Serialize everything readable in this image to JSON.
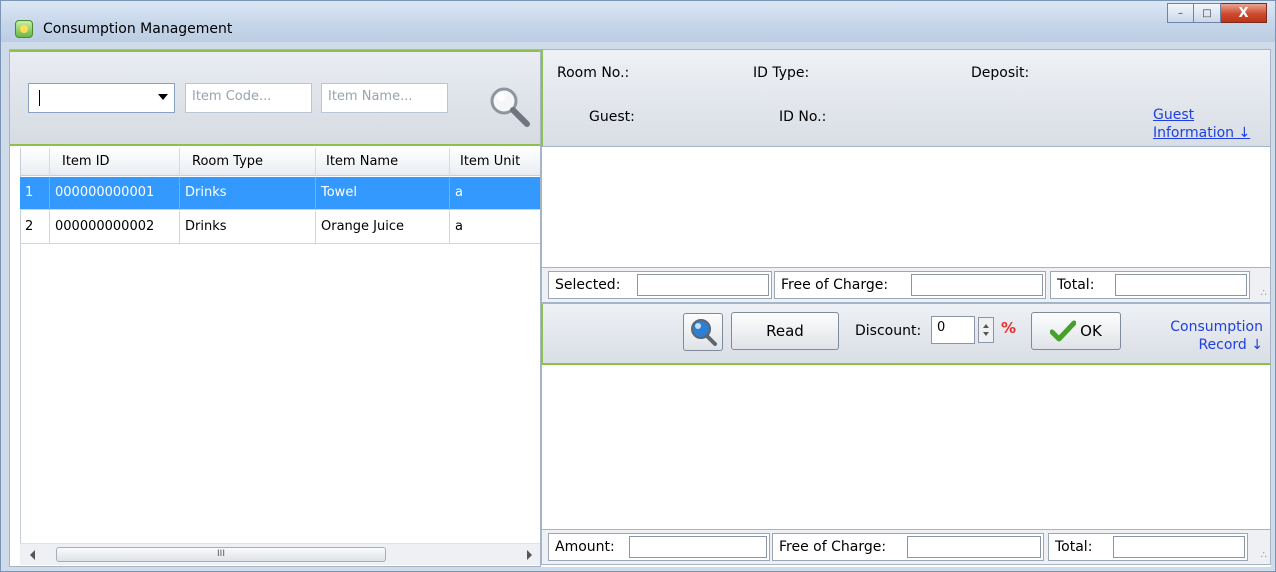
{
  "window": {
    "title": "Consumption Management",
    "controls": {
      "minimize": "–",
      "maximize": "□",
      "close": "X"
    }
  },
  "search": {
    "combo_value": "",
    "item_code_placeholder": "Item Code...",
    "item_name_placeholder": "Item Name..."
  },
  "grid": {
    "columns": [
      "Item ID",
      "Room Type",
      "Item Name",
      "Item Unit"
    ],
    "rows": [
      {
        "num": "1",
        "item_id": "000000000001",
        "room_type": "Drinks",
        "item_name": "Towel",
        "item_unit": "a",
        "selected": true
      },
      {
        "num": "2",
        "item_id": "000000000002",
        "room_type": "Drinks",
        "item_name": "Orange Juice",
        "item_unit": "a",
        "selected": false
      }
    ],
    "scroll_thumb": "III"
  },
  "info": {
    "room_no_label": "Room No.:",
    "id_type_label": "ID Type:",
    "deposit_label": "Deposit:",
    "guest_label": "Guest:",
    "id_no_label": "ID No.:",
    "guest_info_link_1": "Guest",
    "guest_info_link_2": "Information ↓"
  },
  "summary_top": {
    "selected_label": "Selected:",
    "free_label": "Free of Charge:",
    "total_label": "Total:"
  },
  "actions": {
    "read_label": "Read",
    "discount_label": "Discount:",
    "discount_value": "0",
    "percent": "%",
    "ok_label": "OK",
    "record_link_1": "Consumption",
    "record_link_2": "Record ↓"
  },
  "summary_bottom": {
    "amount_label": "Amount:",
    "free_label": "Free of Charge:",
    "total_label": "Total:"
  },
  "colors": {
    "accent_green": "#8ec14a",
    "selection_blue": "#3399ff",
    "link_blue": "#1f3fe0",
    "percent_red": "#e8302a"
  }
}
